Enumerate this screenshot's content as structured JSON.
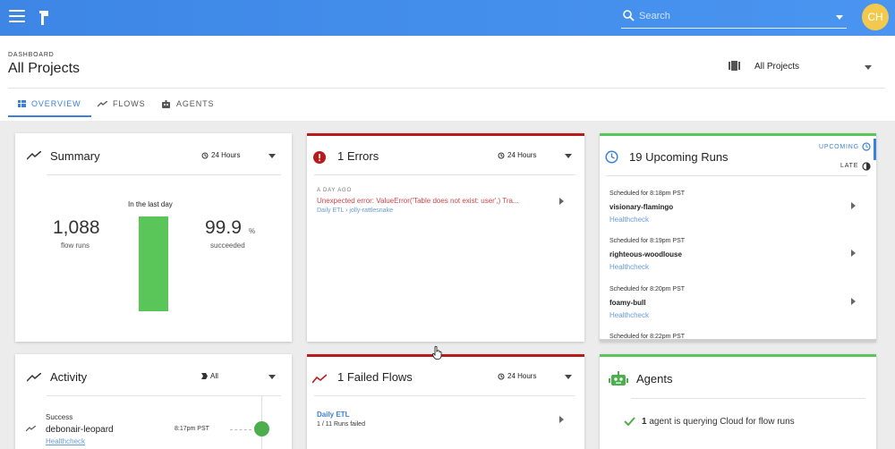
{
  "appbar": {
    "search_placeholder": "Search",
    "avatar_initials": "CH",
    "colors": {
      "primary": "#3d86e6",
      "avatar": "#f2c94c"
    }
  },
  "header": {
    "breadcrumb": "DASHBOARD",
    "title": "All Projects",
    "project_select": "All Projects"
  },
  "tabs": [
    {
      "label": "OVERVIEW",
      "icon": "overview-icon",
      "active": true
    },
    {
      "label": "FLOWS",
      "icon": "trend-icon",
      "active": false
    },
    {
      "label": "AGENTS",
      "icon": "robot-icon",
      "active": false
    }
  ],
  "summary": {
    "title": "Summary",
    "range": "24 Hours",
    "period_label": "In the last day",
    "flow_runs_value": "1,088",
    "flow_runs_label": "flow runs",
    "success_value": "99.9",
    "success_unit": "%",
    "success_label": "succeeded",
    "success_fraction": 0.999
  },
  "errors": {
    "title": "1 Errors",
    "range": "24 Hours",
    "items": [
      {
        "ago": "A DAY AGO",
        "message": "Unexpected error: ValueError('Table does not exist: user',) Tra...",
        "flow": "Daily ETL",
        "run": "jolly-rattlesnake"
      }
    ],
    "colors": {
      "accent": "#b71c1c",
      "message": "#d0454c"
    }
  },
  "upcoming": {
    "title": "19 Upcoming Runs",
    "tab_upcoming": "UPCOMING",
    "tab_late": "LATE",
    "runs": [
      {
        "scheduled": "Scheduled for 8:18pm PST",
        "name": "visionary-flamingo",
        "flow": "Healthcheck"
      },
      {
        "scheduled": "Scheduled for 8:19pm PST",
        "name": "righteous-woodlouse",
        "flow": "Healthcheck"
      },
      {
        "scheduled": "Scheduled for 8:20pm PST",
        "name": "foamy-bull",
        "flow": "Healthcheck"
      },
      {
        "scheduled": "Scheduled for 8:22pm PST",
        "name": "",
        "flow": ""
      }
    ],
    "colors": {
      "accent": "#5ac65a"
    }
  },
  "activity": {
    "title": "Activity",
    "filter": "All",
    "items": [
      {
        "status": "Success",
        "name": "debonair-leopard",
        "link": "Healthcheck",
        "time": "8:17pm PST"
      }
    ]
  },
  "failed_flows": {
    "title": "1 Failed Flows",
    "range": "24 Hours",
    "items": [
      {
        "name": "Daily ETL",
        "summary": "1 / 11 Runs failed"
      }
    ]
  },
  "agents": {
    "title": "Agents",
    "count": "1",
    "message": "agent is querying Cloud for flow runs"
  }
}
